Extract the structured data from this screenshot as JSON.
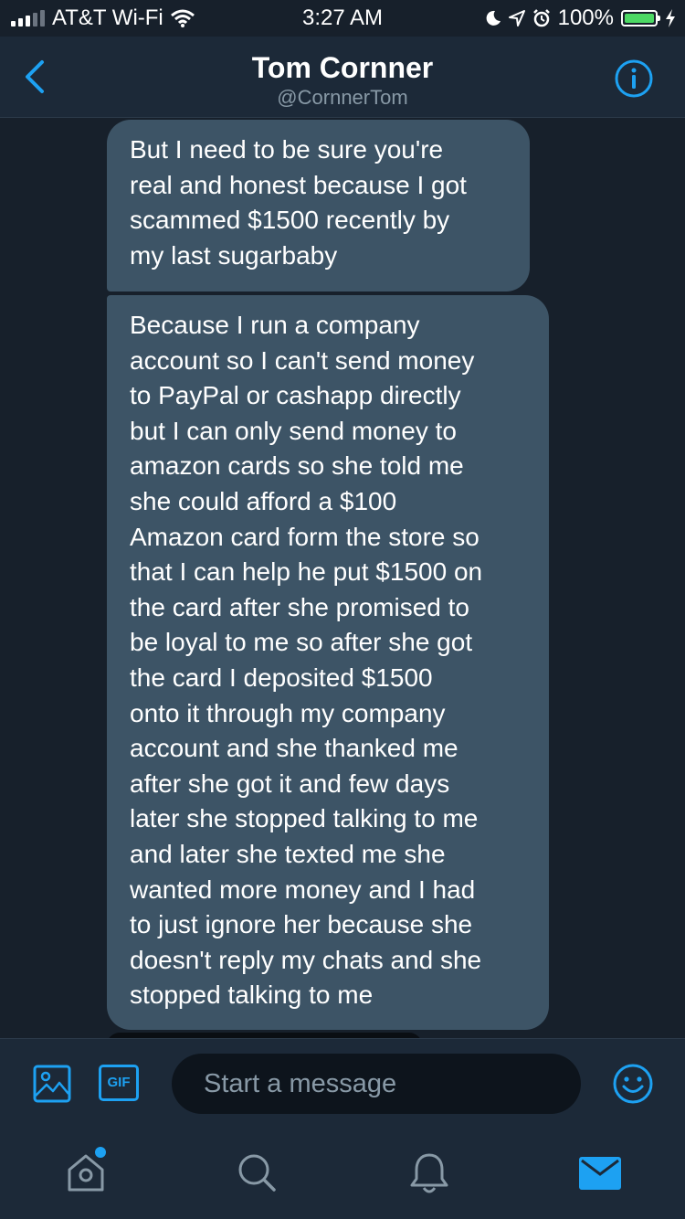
{
  "status_bar": {
    "carrier": "AT&T Wi-Fi",
    "time": "3:27 AM",
    "battery": "100%",
    "battery_level": 1.0
  },
  "header": {
    "name": "Tom Cornner",
    "handle": "@CornnerTom",
    "back_icon": "chevron-left-icon",
    "info_icon": "info-icon"
  },
  "messages": [
    {
      "text": "But I need to be sure you're\nreal and honest because I got\nscammed $1500 recently by\nmy last sugarbaby"
    },
    {
      "text": "Because I run a company\naccount so I can't send money\nto PayPal or cashapp directly\nbut I can only send money to\namazon cards  so she told me\nshe could afford a $100\nAmazon card form the store so\nthat I can help he put $1500 on\nthe card after she promised to\nbe loyal to me so after she got\nthe card I deposited $1500\nonto it through my company\naccount and she thanked me\nafter she got it and few days\nlater she stopped talking to me\nand later she texted me she\nwanted more money and I had\nto just ignore her because she\ndoesn't reply my chats and she\nstopped talking to me"
    }
  ],
  "composer": {
    "placeholder": "Start a message",
    "gif_label": "GIF"
  },
  "tabs": [
    "home-icon",
    "search-icon",
    "notifications-icon",
    "messages-icon"
  ],
  "colors": {
    "accent": "#1da1f2",
    "background": "#17202b",
    "bar": "#1c2938",
    "bubble": "#3d5466",
    "muted": "#8899a6"
  }
}
